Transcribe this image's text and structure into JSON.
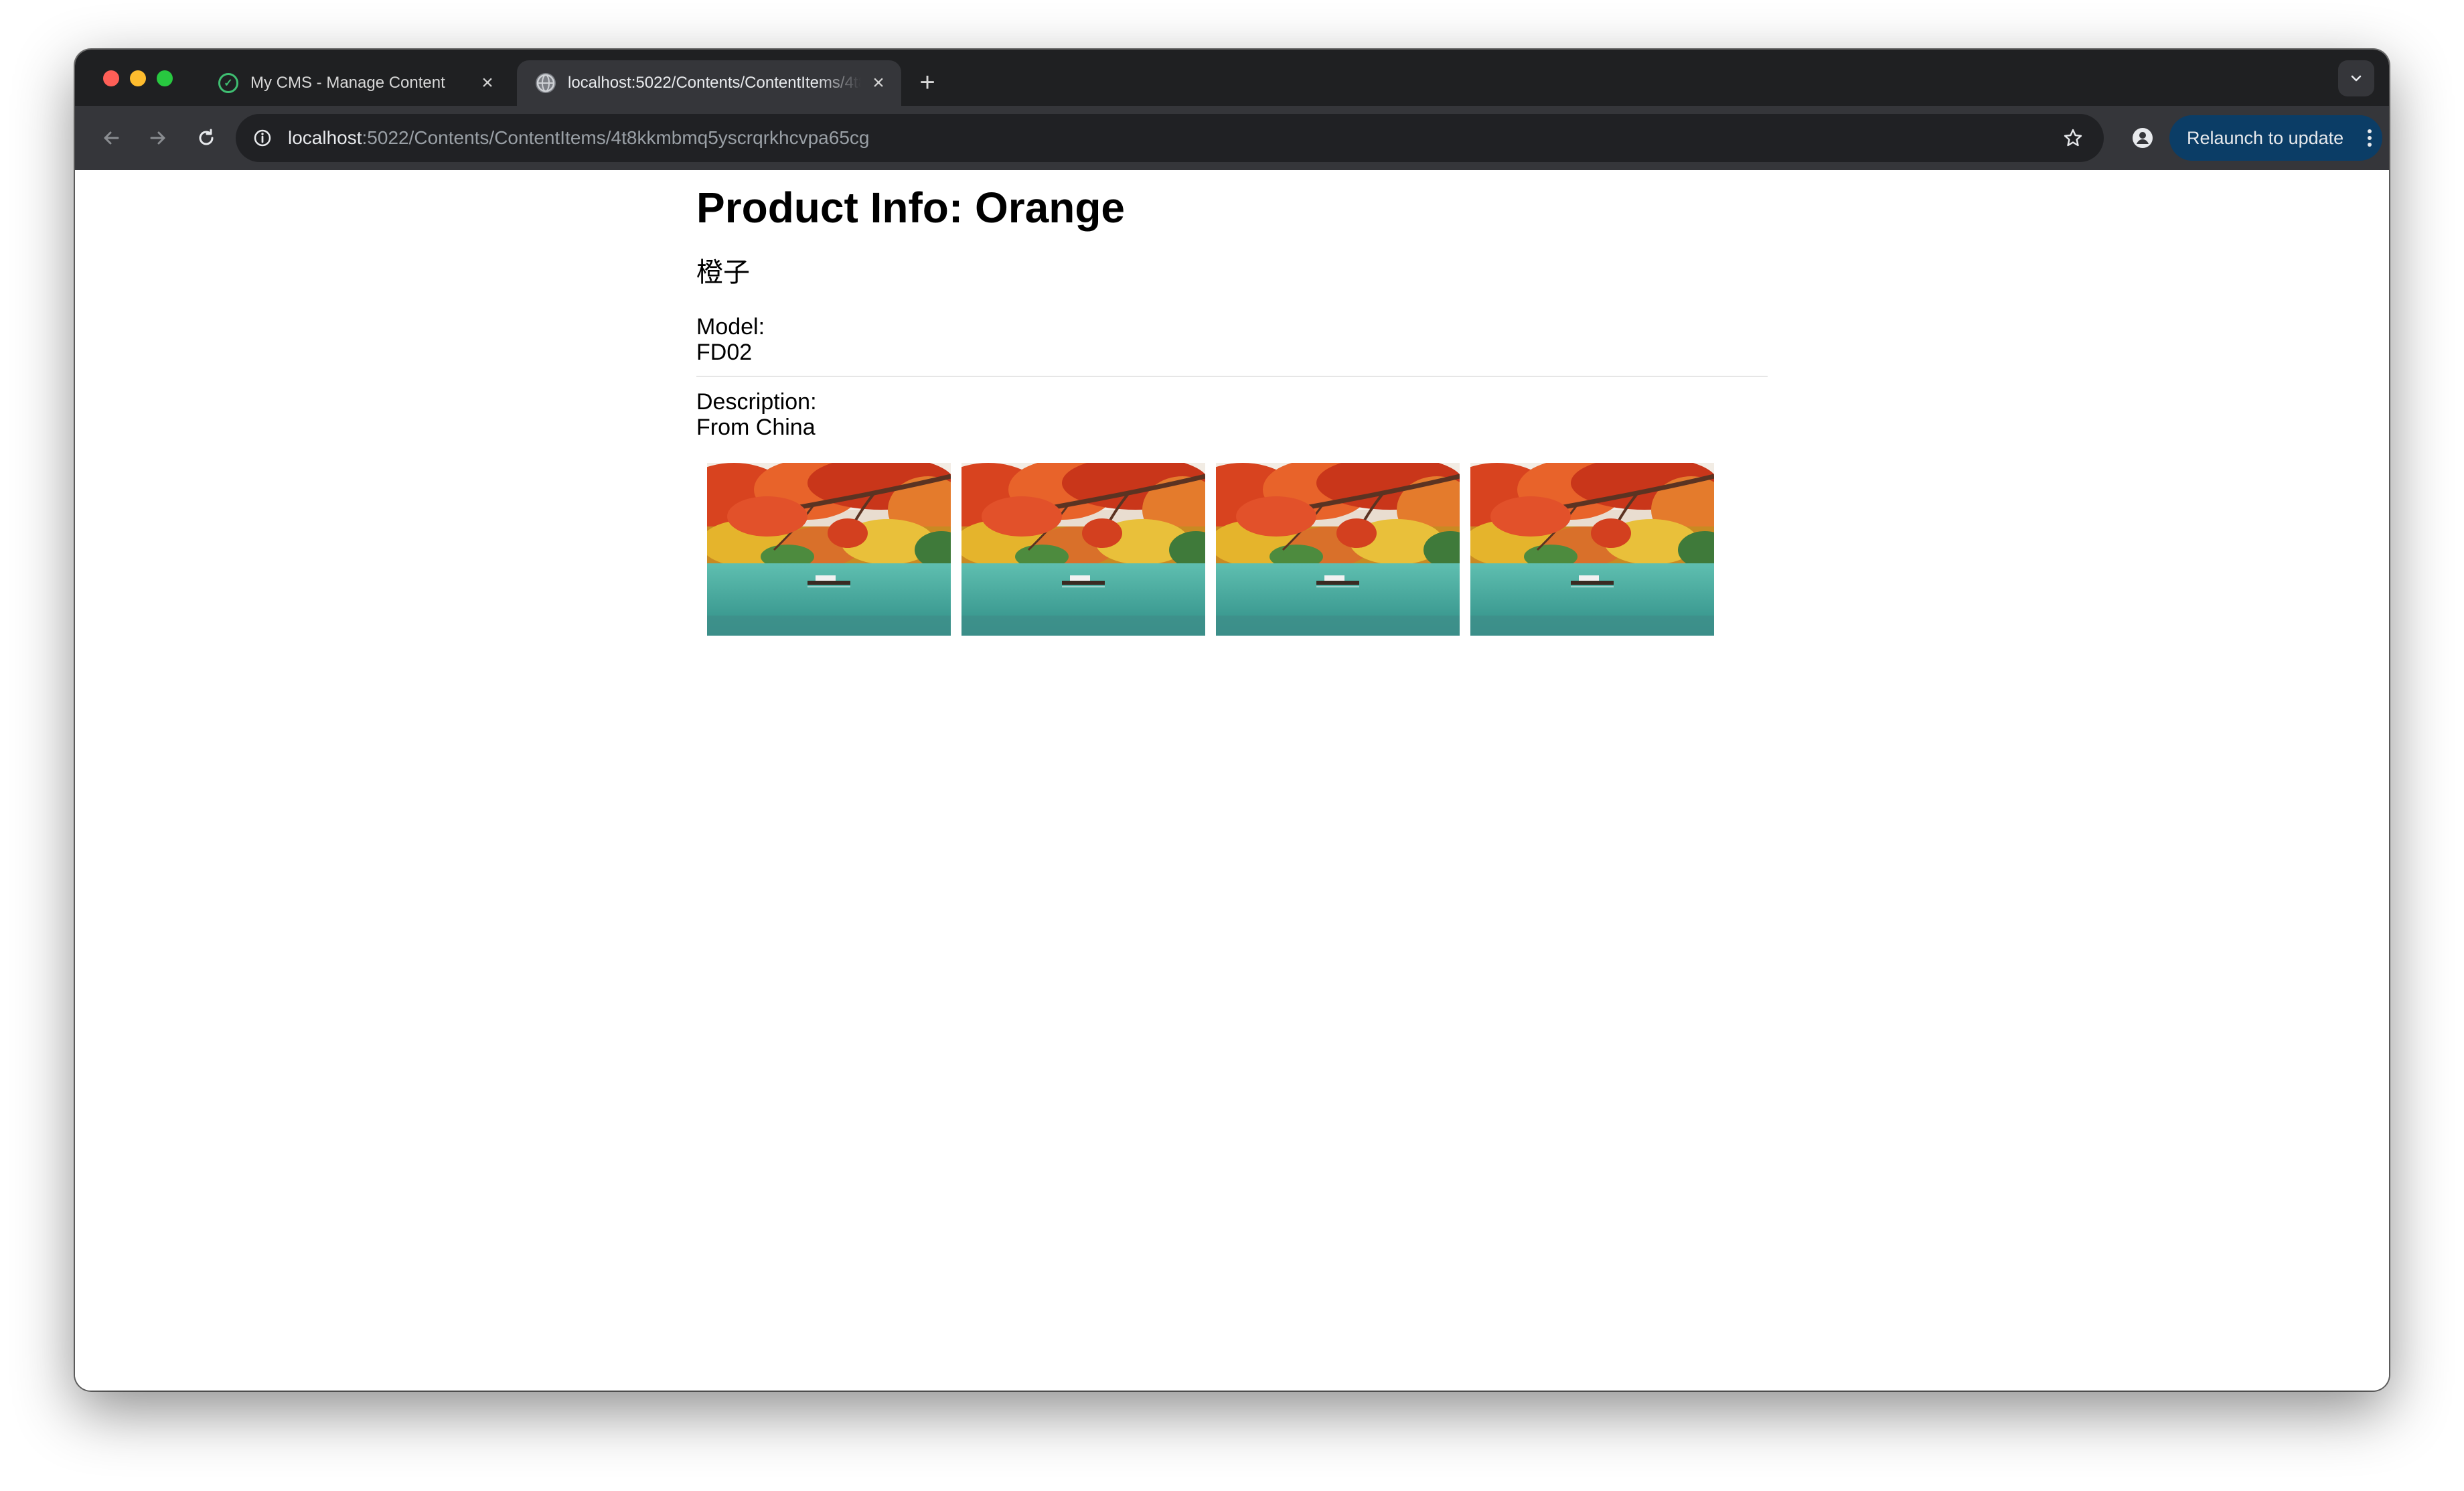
{
  "browser": {
    "tabs": [
      {
        "title": "My CMS - Manage Content",
        "active": false
      },
      {
        "title": "localhost:5022/Contents/ContentItems/4t8kkmbmq5yscrqrkhcvpa65cg",
        "active": true
      }
    ],
    "address_bar": {
      "host": "localhost",
      "path": ":5022/Contents/ContentItems/4t8kkmbmq5yscrqrkhcvpa65cg"
    },
    "relaunch_label": "Relaunch to update"
  },
  "page": {
    "title": "Product Info: Orange",
    "subtitle": "橙子",
    "model_label": "Model:",
    "model_value": "FD02",
    "description_label": "Description:",
    "description_value": "From China",
    "gallery_count": 4
  },
  "colors": {
    "tab_strip": "#1f2022",
    "toolbar": "#35363a",
    "relaunch_button": "#0b3d66"
  }
}
